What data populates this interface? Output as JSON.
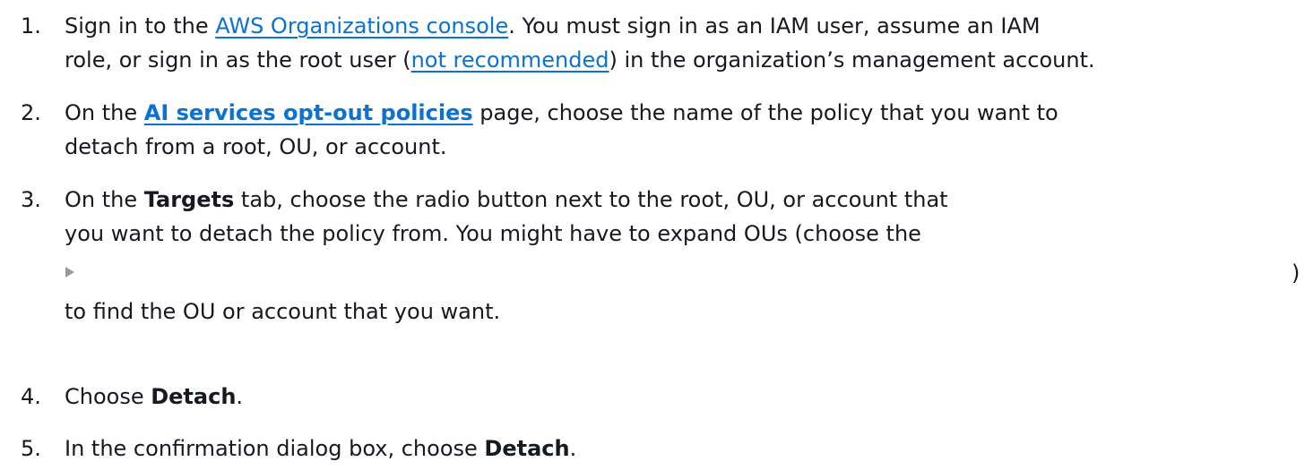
{
  "steps": [
    {
      "number": "1.",
      "line1": {
        "pre": "Sign in to the ",
        "link": "AWS Organizations console",
        "post": ". You must sign in as an IAM user, assume an IAM"
      },
      "line2": {
        "pre": "role, or sign in as the root user (",
        "link": "not recommended",
        "post": ") in the organization’s management account."
      }
    },
    {
      "number": "2.",
      "line1": {
        "pre": "On the ",
        "link": "AI services opt-out policies",
        "post": " page, choose the name of the policy that you want to"
      },
      "line2": "detach from a root, OU, or account."
    },
    {
      "number": "3.",
      "line1": {
        "pre": "On the ",
        "bold": "Targets",
        "post": " tab, choose the radio button next to the root, OU, or account that"
      },
      "line2": "you want to detach the policy from. You might have to expand OUs (choose the",
      "icon": "expand-arrow-icon",
      "close_paren": ")",
      "line4": "to find the OU or account that you want."
    },
    {
      "number": "4.",
      "pre": "Choose ",
      "bold": "Detach",
      "post": "."
    },
    {
      "number": "5.",
      "pre": "In the confirmation dialog box, choose ",
      "bold": "Detach",
      "post": "."
    }
  ],
  "colors": {
    "text": "#16191f",
    "link": "#0972d3",
    "icon": "#999999"
  }
}
